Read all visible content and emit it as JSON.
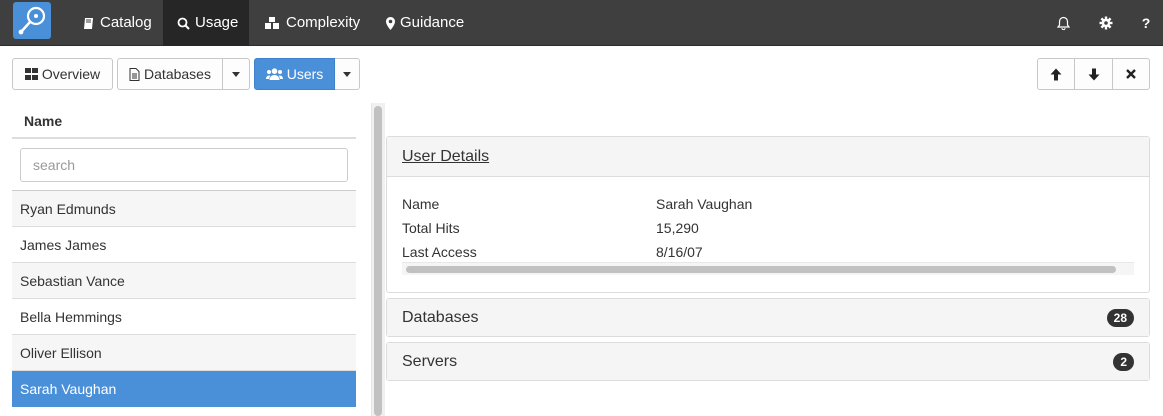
{
  "nav": {
    "items": [
      {
        "label": "Catalog",
        "icon": "book-icon"
      },
      {
        "label": "Usage",
        "icon": "search-icon",
        "active": true
      },
      {
        "label": "Complexity",
        "icon": "cubes-icon"
      },
      {
        "label": "Guidance",
        "icon": "map-marker-icon"
      }
    ],
    "right_icons": [
      "bell-icon",
      "gear-icon",
      "question-icon"
    ],
    "help_label": "?"
  },
  "toolbar": {
    "overview_label": "Overview",
    "databases_label": "Databases",
    "users_label": "Users"
  },
  "list": {
    "column_header": "Name",
    "search_placeholder": "search",
    "users": [
      {
        "name": "Ryan Edmunds"
      },
      {
        "name": "James James"
      },
      {
        "name": "Sebastian Vance"
      },
      {
        "name": "Bella Hemmings"
      },
      {
        "name": "Oliver Ellison"
      },
      {
        "name": "Sarah Vaughan",
        "selected": true
      }
    ]
  },
  "details": {
    "title": "User Details",
    "rows": [
      {
        "label": "Name",
        "value": "Sarah Vaughan"
      },
      {
        "label": "Total Hits",
        "value": "15,290"
      },
      {
        "label": "Last Access",
        "value": "8/16/07"
      }
    ]
  },
  "sections": [
    {
      "title": "Databases",
      "count": "28"
    },
    {
      "title": "Servers",
      "count": "2"
    }
  ],
  "colors": {
    "accent": "#4a90d9",
    "navbar": "#3f3f3f",
    "navbar_active": "#262626"
  }
}
